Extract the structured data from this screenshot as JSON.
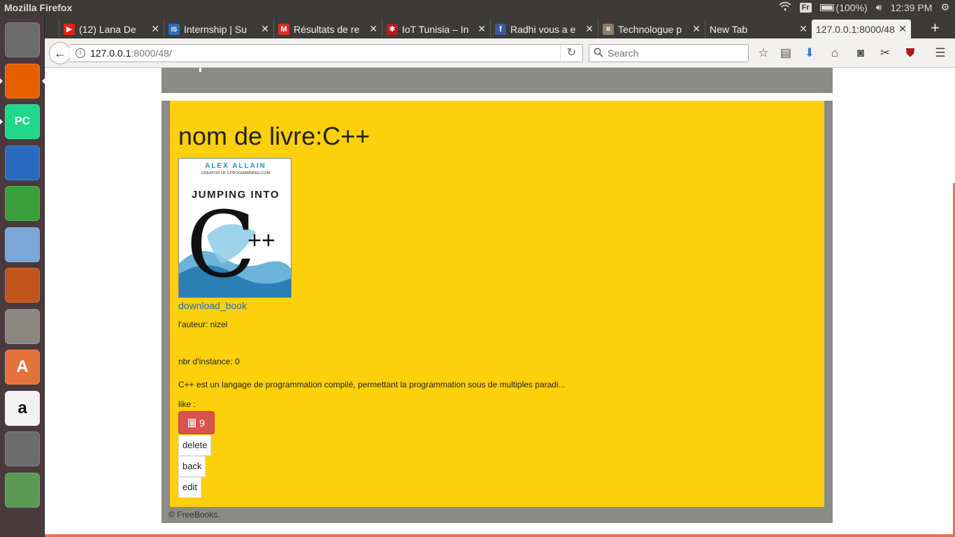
{
  "system": {
    "app_title": "Mozilla Firefox",
    "keyboard_layout": "Fr",
    "battery": "(100%)",
    "time": "12:39 PM"
  },
  "launcher": {
    "items": [
      {
        "name": "dash",
        "label": "",
        "color": "#6c6c6c"
      },
      {
        "name": "firefox",
        "label": "",
        "color": "#e66000"
      },
      {
        "name": "pycharm",
        "label": "PC",
        "color": "#21d789"
      },
      {
        "name": "writer",
        "label": "",
        "color": "#2a6bbf"
      },
      {
        "name": "calc",
        "label": "",
        "color": "#3ba03a"
      },
      {
        "name": "virtualbox",
        "label": "",
        "color": "#7aa7d6"
      },
      {
        "name": "impress",
        "label": "",
        "color": "#c1551c"
      },
      {
        "name": "files",
        "label": "",
        "color": "#8b8680"
      },
      {
        "name": "software-center",
        "label": "A",
        "color": "#e4723a"
      },
      {
        "name": "amazon",
        "label": "a",
        "color": "#f2f2f2"
      },
      {
        "name": "settings",
        "label": "",
        "color": "#6d6d6d"
      },
      {
        "name": "android-studio",
        "label": "",
        "color": "#5a9a54"
      }
    ]
  },
  "tabs": [
    {
      "label": "(12) Lana De",
      "icon": "youtube-icon",
      "icon_color": "#e62117",
      "icon_glyph": "▶"
    },
    {
      "label": "Internship | Su",
      "icon": "is-icon",
      "icon_color": "#2b6fb6",
      "icon_glyph": "IS"
    },
    {
      "label": "Résultats de re",
      "icon": "gmail-icon",
      "icon_color": "#d93025",
      "icon_glyph": "M"
    },
    {
      "label": "IoT Tunisia – In",
      "icon": "iot-icon",
      "icon_color": "#b71c1c",
      "icon_glyph": "✱"
    },
    {
      "label": "Radhi vous a e",
      "icon": "facebook-icon",
      "icon_color": "#3b5998",
      "icon_glyph": "f"
    },
    {
      "label": "Technologue p",
      "icon": "techno-icon",
      "icon_color": "#8a7f6a",
      "icon_glyph": "¤"
    },
    {
      "label": "New Tab",
      "icon": "",
      "icon_color": "",
      "icon_glyph": ""
    },
    {
      "label": "127.0.0.1:8000/48",
      "icon": "",
      "icon_color": "",
      "icon_glyph": "",
      "active": true
    }
  ],
  "navbar": {
    "url_host": "127.0.0.1",
    "url_path": ":8000/48/",
    "search_placeholder": "Search"
  },
  "page": {
    "title": "nom de livre:C++",
    "cover": {
      "author_line": "ALEX ALLAIN",
      "subtitle_line": "CREATOR OF CPROGRAMMING.COM",
      "heading": "JUMPING INTO",
      "big_letter": "C",
      "plus": "++"
    },
    "download_link": "download_book",
    "author": "l'auteur: nizel",
    "instances": "nbr d'instance: 0",
    "description": "C++ est un langage de programmation compilé, permettant la programmation sous de multiples paradi...",
    "like_label": "like :",
    "like_count": "9",
    "delete_label": "delete",
    "back_label": "back",
    "edit_label": "edit",
    "footer": "© FreeBooks."
  },
  "colors": {
    "panel": "#fcd00a",
    "frame": "#8a8a86",
    "like_button": "#d9534f",
    "link": "#2a6ab8"
  }
}
